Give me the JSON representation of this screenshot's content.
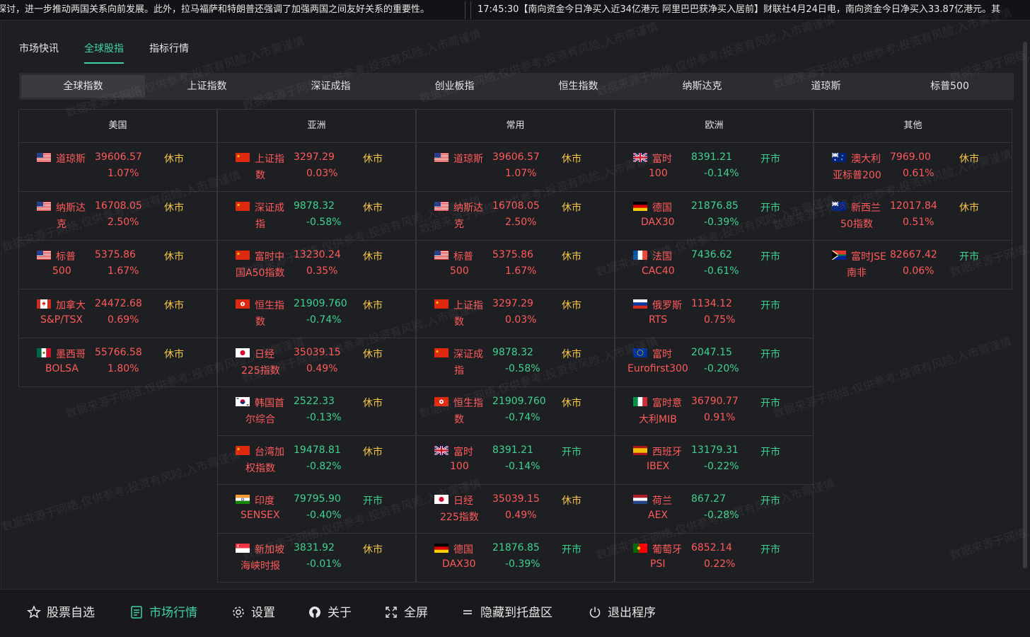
{
  "ticker": {
    "item1": "探讨，进一步推动两国关系向前发展。此外，拉马福萨和特朗普还强调了加强两国之间友好关系的重要性。",
    "item2": "17:45:30【南向资金今日净买入近34亿港元 阿里巴巴获净买入居前】财联社4月24日电，南向资金今日净买入33.87亿港元。其"
  },
  "tabs": [
    "市场快讯",
    "全球股指",
    "指标行情"
  ],
  "active_tab": "全球股指",
  "subtabs": [
    "全球指数",
    "上证指数",
    "深证成指",
    "创业板指",
    "恒生指数",
    "纳斯达克",
    "道琼斯",
    "标普500"
  ],
  "active_subtab": "全球指数",
  "watermark": "数据来源于网络,仅供参考;投资有风险,入市需谨慎",
  "columns": [
    {
      "title": "美国",
      "rows": [
        {
          "flag": "us",
          "name1": "道琼斯",
          "name2": "",
          "value": "39606.57",
          "change": "1.07%",
          "dir": "up",
          "status": "休市"
        },
        {
          "flag": "us",
          "name1": "纳斯达",
          "name2": "克",
          "value": "16708.05",
          "change": "2.50%",
          "dir": "up",
          "status": "休市"
        },
        {
          "flag": "us",
          "name1": "标普",
          "name2": "500",
          "value": "5375.86",
          "change": "1.67%",
          "dir": "up",
          "status": "休市"
        },
        {
          "flag": "ca",
          "name1": "加拿大",
          "name2": "S&P/TSX",
          "value": "24472.68",
          "change": "0.69%",
          "dir": "up",
          "status": "休市"
        },
        {
          "flag": "mx",
          "name1": "墨西哥",
          "name2": "BOLSA",
          "value": "55766.58",
          "change": "1.80%",
          "dir": "up",
          "status": "休市"
        }
      ]
    },
    {
      "title": "亚洲",
      "rows": [
        {
          "flag": "cn",
          "name1": "上证指",
          "name2": "数",
          "value": "3297.29",
          "change": "0.03%",
          "dir": "up",
          "status": "休市"
        },
        {
          "flag": "cn",
          "name1": "深证成",
          "name2": "指",
          "value": "9878.32",
          "change": "-0.58%",
          "dir": "down",
          "status": "休市"
        },
        {
          "flag": "cn",
          "name1": "富时中",
          "name2": "国A50指数",
          "value": "13230.24",
          "change": "0.35%",
          "dir": "up",
          "status": "休市"
        },
        {
          "flag": "hk",
          "name1": "恒生指",
          "name2": "数",
          "value": "21909.760",
          "change": "-0.74%",
          "dir": "down",
          "status": "休市"
        },
        {
          "flag": "jp",
          "name1": "日经",
          "name2": "225指数",
          "value": "35039.15",
          "change": "0.49%",
          "dir": "up",
          "status": "休市"
        },
        {
          "flag": "kr",
          "name1": "韩国首",
          "name2": "尔综合",
          "value": "2522.33",
          "change": "-0.13%",
          "dir": "down",
          "status": "休市"
        },
        {
          "flag": "cn",
          "name1": "台湾加",
          "name2": "权指数",
          "value": "19478.81",
          "change": "-0.82%",
          "dir": "down",
          "status": "休市"
        },
        {
          "flag": "in",
          "name1": "印度",
          "name2": "SENSEX",
          "value": "79795.90",
          "change": "-0.40%",
          "dir": "down",
          "status": "开市"
        },
        {
          "flag": "sg",
          "name1": "新加坡",
          "name2": "海峡时报",
          "value": "3831.92",
          "change": "-0.01%",
          "dir": "down",
          "status": "休市"
        }
      ]
    },
    {
      "title": "常用",
      "rows": [
        {
          "flag": "us",
          "name1": "道琼斯",
          "name2": "",
          "value": "39606.57",
          "change": "1.07%",
          "dir": "up",
          "status": "休市"
        },
        {
          "flag": "us",
          "name1": "纳斯达",
          "name2": "克",
          "value": "16708.05",
          "change": "2.50%",
          "dir": "up",
          "status": "休市"
        },
        {
          "flag": "us",
          "name1": "标普",
          "name2": "500",
          "value": "5375.86",
          "change": "1.67%",
          "dir": "up",
          "status": "休市"
        },
        {
          "flag": "cn",
          "name1": "上证指",
          "name2": "数",
          "value": "3297.29",
          "change": "0.03%",
          "dir": "up",
          "status": "休市"
        },
        {
          "flag": "cn",
          "name1": "深证成",
          "name2": "指",
          "value": "9878.32",
          "change": "-0.58%",
          "dir": "down",
          "status": "休市"
        },
        {
          "flag": "hk",
          "name1": "恒生指",
          "name2": "数",
          "value": "21909.760",
          "change": "-0.74%",
          "dir": "down",
          "status": "休市"
        },
        {
          "flag": "gb",
          "name1": "富时",
          "name2": "100",
          "value": "8391.21",
          "change": "-0.14%",
          "dir": "down",
          "status": "开市"
        },
        {
          "flag": "jp",
          "name1": "日经",
          "name2": "225指数",
          "value": "35039.15",
          "change": "0.49%",
          "dir": "up",
          "status": "休市"
        },
        {
          "flag": "de",
          "name1": "德国",
          "name2": "DAX30",
          "value": "21876.85",
          "change": "-0.39%",
          "dir": "down",
          "status": "开市"
        }
      ]
    },
    {
      "title": "欧洲",
      "rows": [
        {
          "flag": "gb",
          "name1": "富时",
          "name2": "100",
          "value": "8391.21",
          "change": "-0.14%",
          "dir": "down",
          "status": "开市"
        },
        {
          "flag": "de",
          "name1": "德国",
          "name2": "DAX30",
          "value": "21876.85",
          "change": "-0.39%",
          "dir": "down",
          "status": "开市"
        },
        {
          "flag": "fr",
          "name1": "法国",
          "name2": "CAC40",
          "value": "7436.62",
          "change": "-0.61%",
          "dir": "down",
          "status": "开市"
        },
        {
          "flag": "ru",
          "name1": "俄罗斯",
          "name2": "RTS",
          "value": "1134.12",
          "change": "0.75%",
          "dir": "up",
          "status": "开市"
        },
        {
          "flag": "eu",
          "name1": "富时",
          "name2": "Eurofirst300",
          "value": "2047.15",
          "change": "-0.20%",
          "dir": "down",
          "status": "开市"
        },
        {
          "flag": "it",
          "name1": "富时意",
          "name2": "大利MIB",
          "value": "36790.77",
          "change": "0.91%",
          "dir": "up",
          "status": "开市"
        },
        {
          "flag": "es",
          "name1": "西班牙",
          "name2": "IBEX",
          "value": "13179.31",
          "change": "-0.22%",
          "dir": "down",
          "status": "开市"
        },
        {
          "flag": "nl",
          "name1": "荷兰",
          "name2": "AEX",
          "value": "867.27",
          "change": "-0.28%",
          "dir": "down",
          "status": "开市"
        },
        {
          "flag": "pt",
          "name1": "葡萄牙",
          "name2": "PSI",
          "value": "6852.14",
          "change": "0.22%",
          "dir": "up",
          "status": "开市"
        }
      ]
    },
    {
      "title": "其他",
      "rows": [
        {
          "flag": "au",
          "name1": "澳大利",
          "name2": "亚标普200",
          "value": "7969.00",
          "change": "0.61%",
          "dir": "up",
          "status": "休市"
        },
        {
          "flag": "nz",
          "name1": "新西兰",
          "name2": "50指数",
          "value": "12017.84",
          "change": "0.51%",
          "dir": "up",
          "status": "休市"
        },
        {
          "flag": "za",
          "name1": "富时JSE",
          "name2": "南非",
          "value": "82667.42",
          "change": "0.06%",
          "dir": "up",
          "status": "开市"
        }
      ]
    }
  ],
  "bottom": [
    {
      "icon": "star-icon",
      "label": "股票自选",
      "active": false
    },
    {
      "icon": "market-icon",
      "label": "市场行情",
      "active": true
    },
    {
      "icon": "gear-icon",
      "label": "设置",
      "active": false
    },
    {
      "icon": "github-icon",
      "label": "关于",
      "active": false
    },
    {
      "icon": "fullscreen-icon",
      "label": "全屏",
      "active": false
    },
    {
      "icon": "menu-icon",
      "label": "隐藏到托盘区",
      "active": false
    },
    {
      "icon": "power-icon",
      "label": "退出程序",
      "active": false
    }
  ],
  "colors": {
    "accent": "#3fd2a6",
    "up": "#ff5a5a",
    "down": "#3fd28f",
    "closed": "#f6c64a"
  }
}
